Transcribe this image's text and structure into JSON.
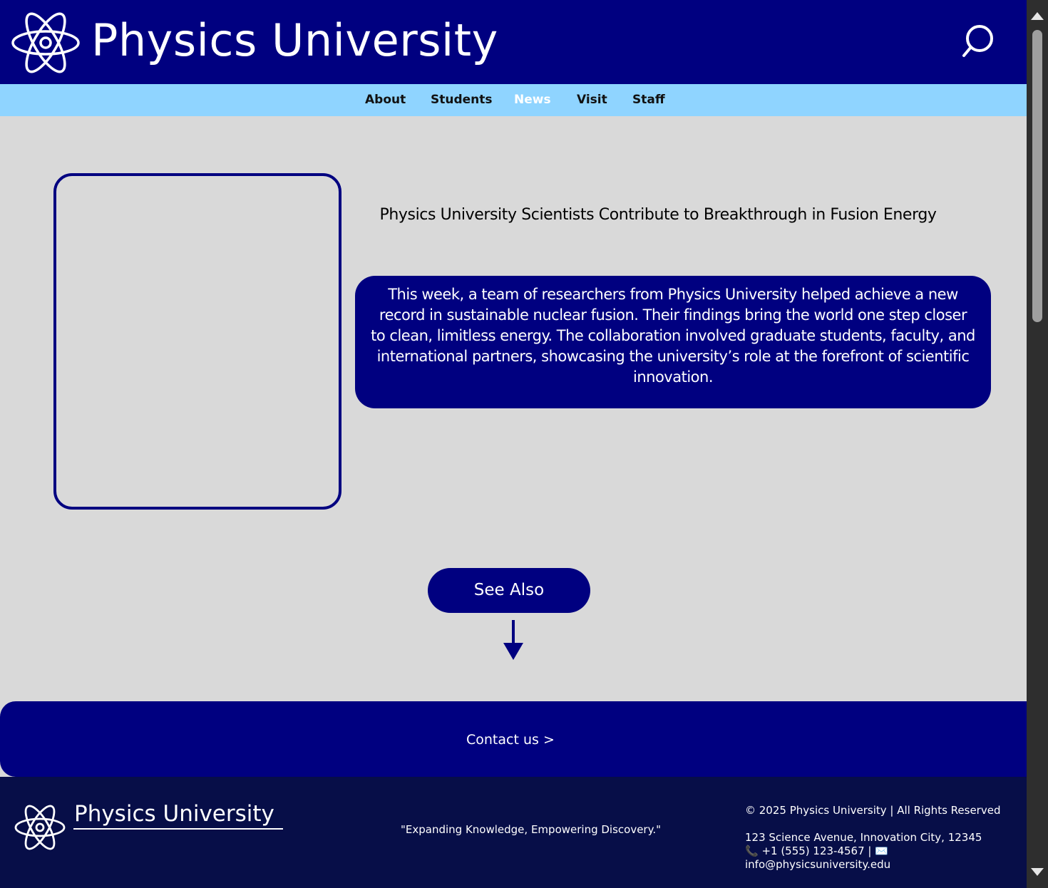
{
  "header": {
    "logo_icon": "atom-icon",
    "site_title": "Physics University",
    "search_icon": "search-icon"
  },
  "nav": {
    "items": [
      {
        "label": "About",
        "active": false
      },
      {
        "label": "Students",
        "active": false
      },
      {
        "label": "News",
        "active": true
      },
      {
        "label": "Visit",
        "active": false
      },
      {
        "label": "Staff",
        "active": false
      }
    ]
  },
  "article": {
    "headline": "Physics University Scientists Contribute to Breakthrough in Fusion Energy",
    "body": "This week, a team of researchers from Physics University helped achieve a new record in sustainable nuclear fusion. Their findings bring the world one step closer to clean, limitless energy. The collaboration involved graduate students, faculty, and international partners, showcasing the university’s role at the forefront of scientific innovation."
  },
  "see_also": {
    "label": "See Also",
    "icon": "arrow-down-icon"
  },
  "contact": {
    "label": "Contact us >"
  },
  "footer": {
    "logo_icon": "atom-icon",
    "title": "Physics University",
    "tagline": "\"Expanding Knowledge, Empowering Discovery.\"",
    "copyright": "© 2025 Physics University | All Rights Reserved",
    "address": "123 Science Avenue, Innovation City, 12345",
    "contact_line": "📞 +1 (555) 123-4567 | ✉️",
    "email": "info@physicsuniversity.edu"
  },
  "colors": {
    "primary_navy": "#000080",
    "nav_light_blue": "#8fd4ff",
    "page_background": "#d9d9d9",
    "footer_dark": "#070e48",
    "scrollbar": "#2e2e2e"
  }
}
